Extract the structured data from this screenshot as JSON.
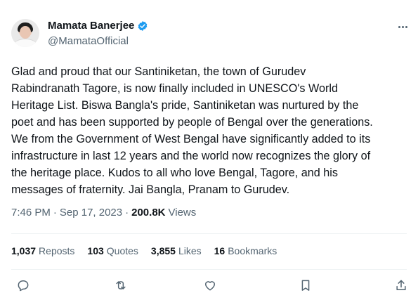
{
  "author": {
    "display_name": "Mamata Banerjee",
    "handle": "@MamataOfficial",
    "verified": true
  },
  "tweet": {
    "lines": [
      "Glad and proud that our Santiniketan, the town of Gurudev",
      "Rabindranath Tagore, is now finally included in UNESCO's World",
      "Heritage List. Biswa Bangla's pride, Santiniketan was nurtured by the",
      "poet and has been  supported by people of Bengal over the generations.",
      "We from the Government of West Bengal have significantly added to its",
      "infrastructure in last 12 years and the world now recognizes the glory of",
      "the heritage place. Kudos to all who love Bengal, Tagore, and his",
      "messages of fraternity. Jai Bangla, Pranam to Gurudev."
    ],
    "time": "7:46 PM",
    "separator": "·",
    "date": "Sep 17, 2023",
    "views_count": "200.8K",
    "views_label": "Views"
  },
  "stats": {
    "reposts_count": "1,037",
    "reposts_label": "Reposts",
    "quotes_count": "103",
    "quotes_label": "Quotes",
    "likes_count": "3,855",
    "likes_label": "Likes",
    "bookmarks_count": "16",
    "bookmarks_label": "Bookmarks"
  },
  "icons": {
    "more": "more-options-icon",
    "verified": "verified-badge-icon",
    "reply": "reply-icon",
    "repost": "repost-icon",
    "like": "like-icon",
    "bookmark": "bookmark-icon",
    "share": "share-icon"
  },
  "colors": {
    "text_primary": "#0f1419",
    "text_secondary": "#536471",
    "verified_blue": "#1d9bf0",
    "divider": "#eff3f4"
  }
}
